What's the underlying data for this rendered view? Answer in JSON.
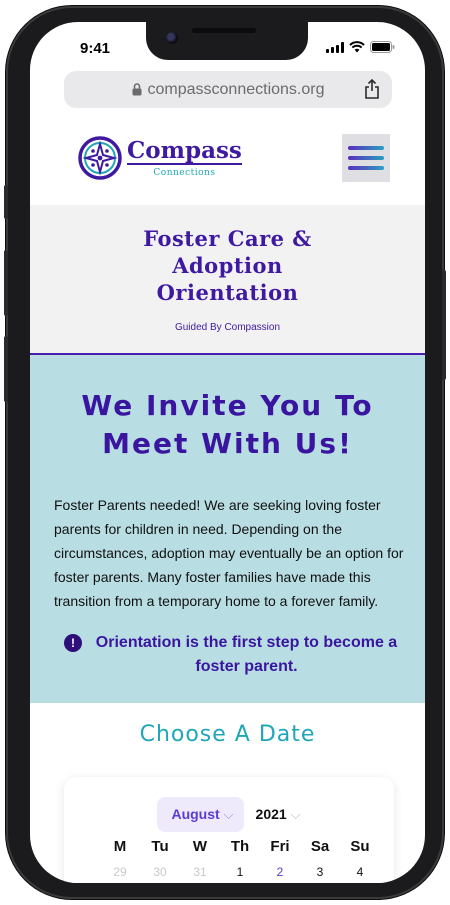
{
  "status": {
    "time": "9:41"
  },
  "browser": {
    "url": "compassconnections.org"
  },
  "brand": {
    "name": "Compass",
    "subtitle": "Connections"
  },
  "hero": {
    "title_lines": [
      "Foster Care &",
      "Adoption",
      "Orientation"
    ],
    "tagline": "Guided By Compassion"
  },
  "invite": {
    "heading_lines": [
      "We Invite You To",
      "Meet With Us!"
    ],
    "body": "Foster Parents needed! We are seeking loving foster parents for children in need. Depending on the circumstances, adoption may eventually be an option for foster parents. Many foster families have made this transition from a temporary home to a forever family.",
    "notice": "Orientation is the first step to become a foster parent."
  },
  "date_section": {
    "heading": "Choose A Date",
    "month": "August",
    "year": "2021",
    "weekdays": [
      "M",
      "Tu",
      "W",
      "Th",
      "Fri",
      "Sa",
      "Su"
    ],
    "first_row": [
      "29",
      "30",
      "31",
      "1",
      "2",
      "3",
      "4"
    ]
  },
  "colors": {
    "brand_purple": "#3f1aa0",
    "teal": "#1fa6b8",
    "invite_bg": "#b8dde2",
    "title_band_bg": "#f2f2f3"
  }
}
